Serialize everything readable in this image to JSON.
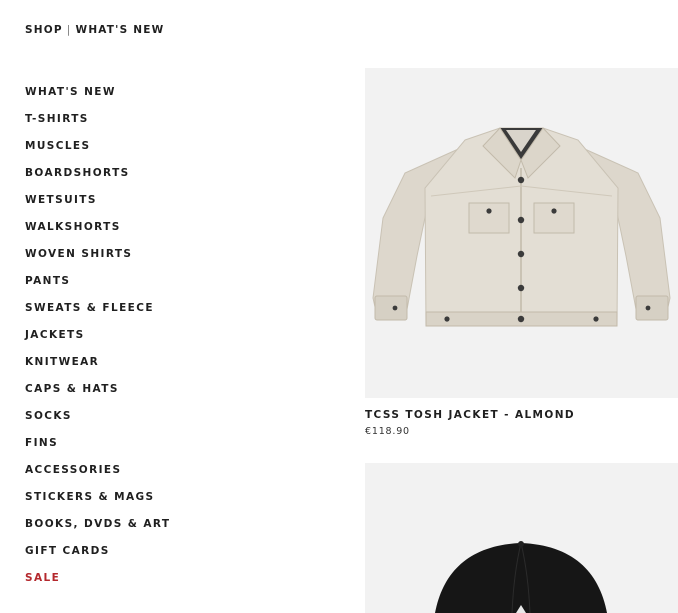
{
  "breadcrumb": {
    "shop": "SHOP",
    "separator": "|",
    "current": "WHAT'S NEW"
  },
  "sidebar": {
    "items": [
      {
        "label": "WHAT'S NEW"
      },
      {
        "label": "T-SHIRTS"
      },
      {
        "label": "MUSCLES"
      },
      {
        "label": "BOARDSHORTS"
      },
      {
        "label": "WETSUITS"
      },
      {
        "label": "WALKSHORTS"
      },
      {
        "label": "WOVEN SHIRTS"
      },
      {
        "label": "PANTS"
      },
      {
        "label": "SWEATS & FLEECE"
      },
      {
        "label": "JACKETS"
      },
      {
        "label": "KNITWEAR"
      },
      {
        "label": "CAPS & HATS"
      },
      {
        "label": "SOCKS"
      },
      {
        "label": "FINS"
      },
      {
        "label": "ACCESSORIES"
      },
      {
        "label": "STICKERS & MAGS"
      },
      {
        "label": "BOOKS, DVDS & ART"
      },
      {
        "label": "GIFT CARDS"
      },
      {
        "label": "SALE",
        "color": "#b4282d"
      }
    ]
  },
  "products": [
    {
      "name": "TCSS TOSH JACKET - ALMOND",
      "price": "€118.90",
      "image": "jacket-almond-image"
    },
    {
      "image": "black-cap-image"
    }
  ],
  "colors": {
    "text": "#1f1f1f",
    "sale": "#b4282d",
    "jacket": "#e2ddd3",
    "image_bg": "#f2f2f2"
  }
}
